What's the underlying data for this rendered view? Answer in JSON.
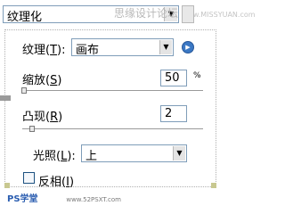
{
  "filter_select": {
    "value": "纹理化"
  },
  "watermark": {
    "cn": "思缘设计论坛",
    "url": "www.MISSYUAN.com"
  },
  "texture": {
    "label": "纹理",
    "shortcut": "T",
    "select_value": "画布"
  },
  "scaling": {
    "label": "缩放",
    "shortcut": "S",
    "value": "50",
    "unit": "%",
    "slider_level_percent": 0
  },
  "relief": {
    "label": "凸现",
    "shortcut": "R",
    "value": "2",
    "slider_level": 2
  },
  "light": {
    "label": "光照",
    "shortcut": "L",
    "select_value": "上"
  },
  "invert": {
    "label": "反相",
    "shortcut": "I",
    "checked": false
  },
  "bottom_watermark": {
    "logo": "PS学堂",
    "url": "www.52PSXT.com"
  },
  "colors": {
    "border": "#7f9db9",
    "accent": "#3b78c4"
  }
}
